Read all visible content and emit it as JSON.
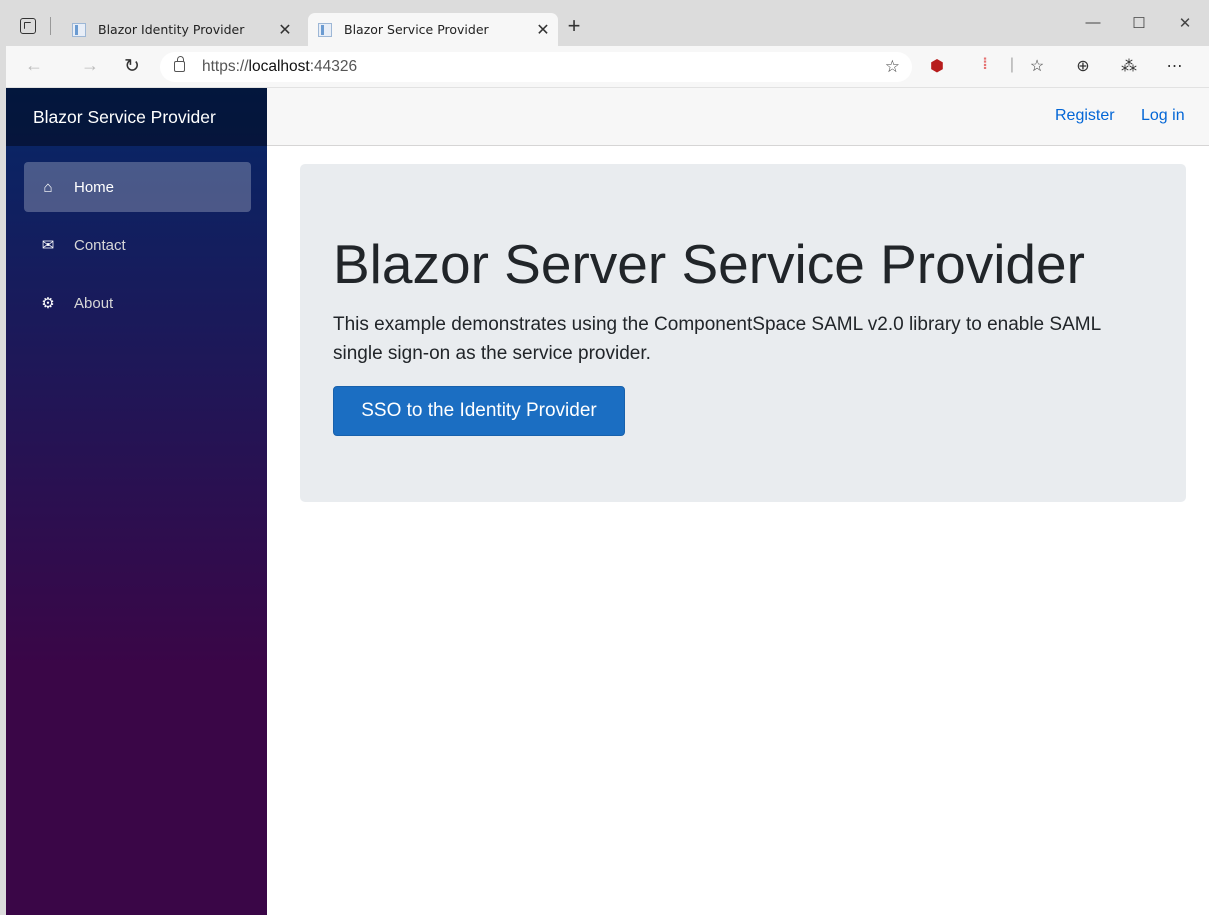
{
  "browser": {
    "tabs": [
      {
        "title": "Blazor Identity Provider",
        "close": "✕"
      },
      {
        "title": "Blazor Service Provider",
        "close": "✕"
      }
    ],
    "new_tab": "+",
    "window_controls": {
      "minimize": "—",
      "maximize": "☐",
      "close": "✕"
    },
    "nav": {
      "back": "←",
      "forward": "→",
      "refresh": "↻"
    },
    "address": {
      "scheme": "https://",
      "host": "localhost",
      "port": ":44326"
    },
    "toolbar_icons": [
      "favorite-add-icon",
      "ublock-icon",
      "toggl-icon",
      "favorites-icon",
      "collections-icon",
      "extensions-icon",
      "more-icon"
    ]
  },
  "sidebar": {
    "brand": "Blazor Service Provider",
    "items": [
      {
        "label": "Home",
        "icon": "home-icon",
        "glyph": "⌂",
        "active": true
      },
      {
        "label": "Contact",
        "icon": "envelope-icon",
        "glyph": "✉",
        "active": false
      },
      {
        "label": "About",
        "icon": "cog-icon",
        "glyph": "⚙",
        "active": false
      }
    ]
  },
  "topbar": {
    "register": "Register",
    "login": "Log in"
  },
  "main": {
    "heading": "Blazor Server Service Provider",
    "lead": "This example demonstrates using the ComponentSpace SAML v2.0 library to enable SAML single sign-on as the service provider.",
    "sso_button": "SSO to the Identity Provider"
  },
  "colors": {
    "link": "#0366d6",
    "primary": "#1b6ec2",
    "sidebar_top": "#052767",
    "sidebar_bottom": "#3a0647",
    "jumbotron": "#e9ecef"
  }
}
